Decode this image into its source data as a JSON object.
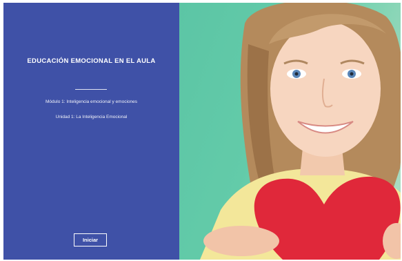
{
  "course": {
    "title": "EDUCACIÓN EMOCIONAL EN EL AULA",
    "module": "Módulo 1: Inteligencia emocional y emociones",
    "unit": "Unidad 1: La Inteligencia Emocional"
  },
  "actions": {
    "start_label": "Iniciar"
  },
  "colors": {
    "panel_bg": "#3f51a7",
    "photo_bg": "#63cba9",
    "heart": "#e0283a"
  },
  "image": {
    "description_icon": "smiling-girl-with-red-heart"
  }
}
